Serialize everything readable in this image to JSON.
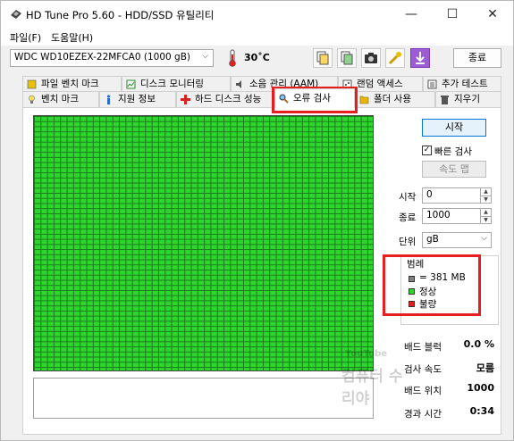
{
  "window": {
    "title": "HD Tune Pro 5.60 - HDD/SSD  유틸리티",
    "minimize_glyph": "—",
    "maximize_glyph": "☐",
    "close_glyph": "✕"
  },
  "menu": {
    "file": "파일(F)",
    "help": "도움말(H)"
  },
  "toolbar": {
    "drive": "WDC WD10EZEX-22MFCA0 (1000 gB)",
    "temperature": "30˚C",
    "exit_label": "종료"
  },
  "tabs_top": [
    {
      "label": "파일 벤치 마크",
      "icon": "file-benchmark-icon"
    },
    {
      "label": "디스크 모니터링",
      "icon": "disk-monitor-icon"
    },
    {
      "label": "소음 관리 (AAM)",
      "icon": "speaker-icon"
    },
    {
      "label": "랜덤 액세스",
      "icon": "random-access-icon"
    },
    {
      "label": "추가 테스트",
      "icon": "extra-tests-icon"
    }
  ],
  "tabs_bottom": [
    {
      "label": "벤치 마크",
      "icon": "lightbulb-icon"
    },
    {
      "label": "지원 정보",
      "icon": "info-icon"
    },
    {
      "label": "하드 디스크 성능",
      "icon": "health-cross-icon"
    },
    {
      "label": "오류 검사",
      "icon": "magnifier-icon"
    },
    {
      "label": "폴더 사용",
      "icon": "folder-icon"
    },
    {
      "label": "지우기",
      "icon": "trash-icon"
    }
  ],
  "scan": {
    "start_button": "시작",
    "quick_scan_label": "빠른 검사",
    "quick_scan_checked": true,
    "speed_map_button": "속도 맵",
    "start_label": "시작",
    "start_value": "0",
    "end_label": "종료",
    "end_value": "1000",
    "unit_label": "단위",
    "unit_value": "gB"
  },
  "legend": {
    "title": "범례",
    "block_size": "= 381 MB",
    "ok_label": "정상",
    "bad_label": "불량",
    "colors": {
      "block": "#808080",
      "ok": "#2fd52f",
      "bad": "#e02020"
    }
  },
  "stats": {
    "bad_blocks_label": "배드 블럭",
    "bad_blocks_value": "0.0 %",
    "scan_speed_label": "검사 속도",
    "scan_speed_value": "모름",
    "position_label": "배드 위치",
    "position_value": "1000",
    "elapsed_label": "경과 시간",
    "elapsed_value": "0:34"
  },
  "watermark": {
    "line1": "YouTube",
    "line2": "컴퓨터 수리야"
  }
}
